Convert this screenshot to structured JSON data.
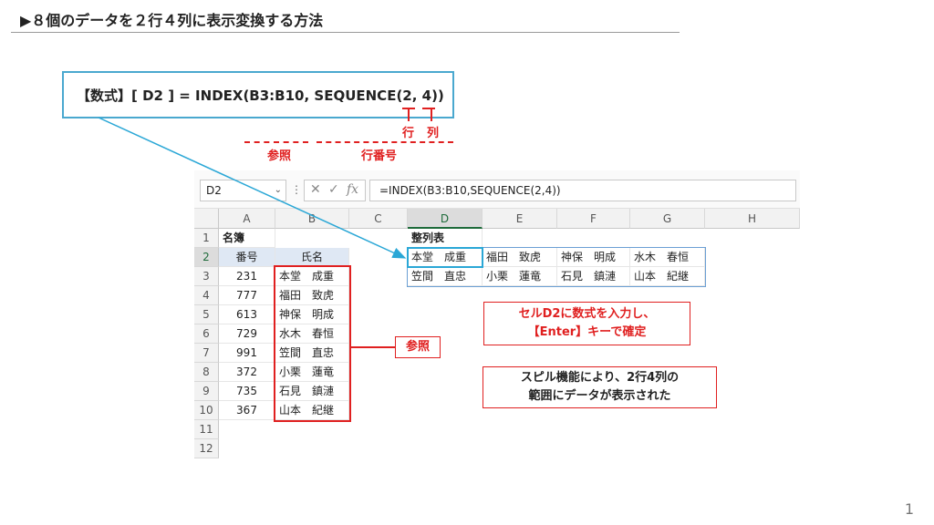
{
  "slide": {
    "title": "▶８個のデータを２行４列に表示変換する方法",
    "page_number": "1"
  },
  "formula_callout": {
    "text": "【数式】[ D2 ] = INDEX(B3:B10, SEQUENCE(2, 4))",
    "label_row": "行",
    "label_col": "列",
    "label_ref": "参照",
    "label_rownum": "行番号"
  },
  "excel": {
    "name_box": "D2",
    "formula_bar": "=INDEX(B3:B10,SEQUENCE(2,4))",
    "fx_label": "fx",
    "columns": [
      "A",
      "B",
      "C",
      "D",
      "E",
      "F",
      "G",
      "H"
    ],
    "rows": [
      "1",
      "2",
      "3",
      "4",
      "5",
      "6",
      "7",
      "8",
      "9",
      "10",
      "11",
      "12"
    ],
    "a1": "名簿",
    "d1": "整列表",
    "header_no": "番号",
    "header_name": "氏名",
    "roster": [
      {
        "no": "231",
        "name": "本堂　成重"
      },
      {
        "no": "777",
        "name": "福田　致虎"
      },
      {
        "no": "613",
        "name": "神保　明成"
      },
      {
        "no": "729",
        "name": "水木　春恒"
      },
      {
        "no": "991",
        "name": "笠間　直忠"
      },
      {
        "no": "372",
        "name": "小栗　蓮竜"
      },
      {
        "no": "735",
        "name": "石見　鎮漣"
      },
      {
        "no": "367",
        "name": "山本　紀継"
      }
    ],
    "spill": [
      [
        "本堂　成重",
        "福田　致虎",
        "神保　明成",
        "水木　春恒"
      ],
      [
        "笠間　直忠",
        "小栗　蓮竜",
        "石見　鎮漣",
        "山本　紀継"
      ]
    ]
  },
  "callouts": {
    "reference": "参照",
    "enter_line1": "セルD2に数式を入力し、",
    "enter_line2": "【Enter】キーで確定",
    "spill_line1": "スピル機能により、2行4列の",
    "spill_line2": "範囲にデータが表示された"
  },
  "colors": {
    "accent_red": "#e02020",
    "accent_blue": "#2aa7d6",
    "excel_green": "#1e6b3a"
  }
}
